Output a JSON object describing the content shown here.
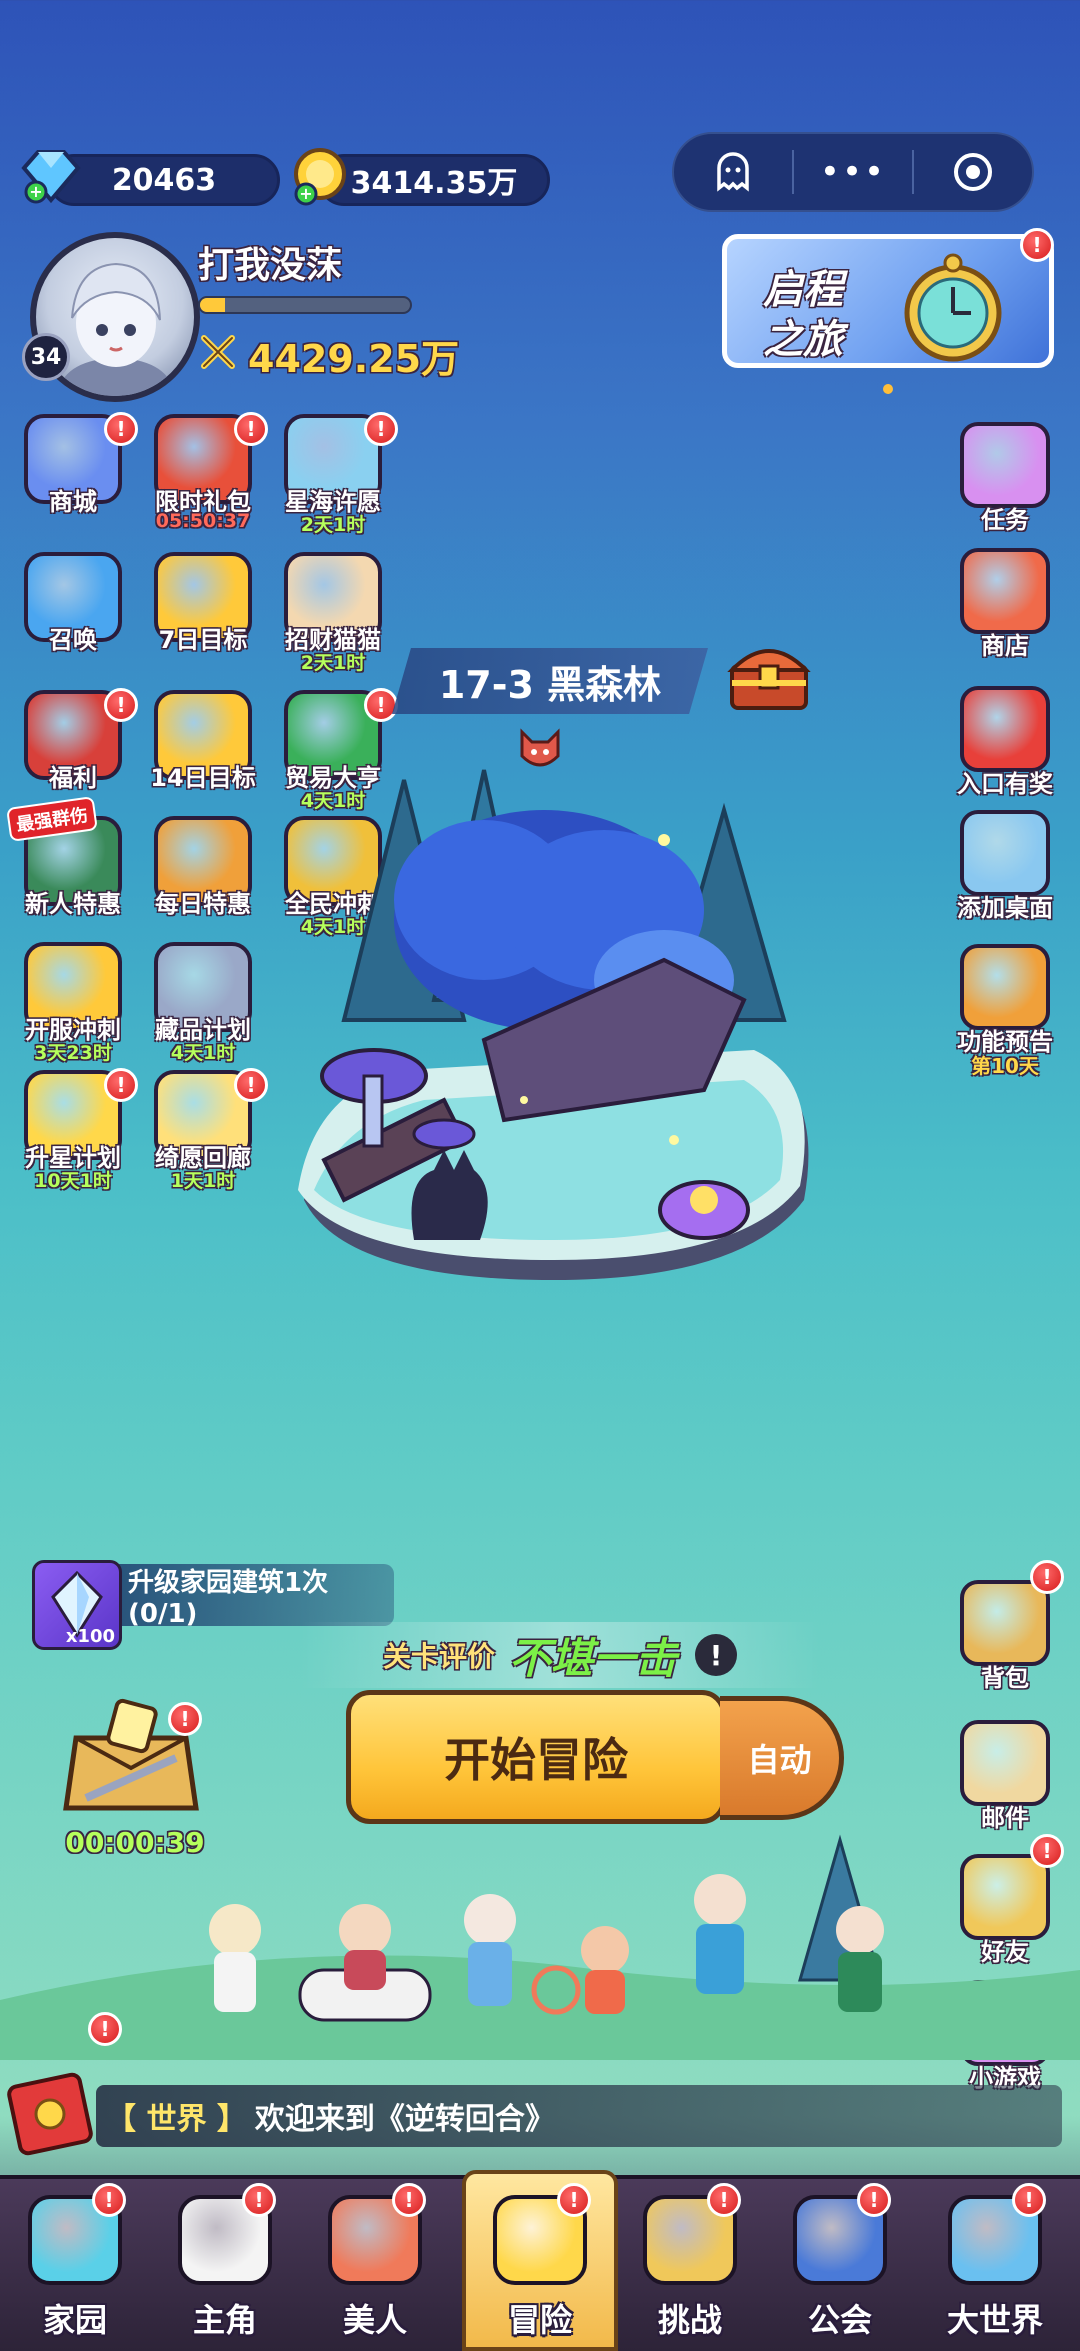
{
  "resources": {
    "diamond": "20463",
    "gold": "3414.35万"
  },
  "capsule": {
    "ghost": "👻",
    "more": "•••",
    "close": "◉"
  },
  "player": {
    "name": "打我没莯",
    "level": "34",
    "power": "4429.25万",
    "exp_fraction": 0.12
  },
  "journey_banner": {
    "line1": "启程",
    "line2": "之旅"
  },
  "left_menu": [
    {
      "label": "商城",
      "sub": ""
    },
    {
      "label": "限时礼包",
      "sub": "05:50:37"
    },
    {
      "label": "星海许愿",
      "sub": "2天1时"
    },
    {
      "label": "召唤",
      "sub": ""
    },
    {
      "label": "7日目标",
      "sub": ""
    },
    {
      "label": "招财猫猫",
      "sub": "2天1时"
    },
    {
      "label": "福利",
      "sub": ""
    },
    {
      "label": "14日目标",
      "sub": ""
    },
    {
      "label": "贸易大亨",
      "sub": "4天1时"
    },
    {
      "label": "新人特惠",
      "sub": "",
      "tag": "最强群伤"
    },
    {
      "label": "每日特惠",
      "sub": ""
    },
    {
      "label": "全民冲刺",
      "sub": "4天1时"
    },
    {
      "label": "开服冲刺",
      "sub": "3天23时"
    },
    {
      "label": "藏品计划",
      "sub": "4天1时"
    },
    {
      "label": "升星计划",
      "sub": "10天1时"
    },
    {
      "label": "绮愿回廊",
      "sub": "1天1时"
    }
  ],
  "right_menu": [
    {
      "label": "任务",
      "sub": ""
    },
    {
      "label": "商店",
      "sub": ""
    },
    {
      "label": "入口有奖",
      "sub": ""
    },
    {
      "label": "添加桌面",
      "sub": ""
    },
    {
      "label": "功能预告",
      "sub": "第10天"
    },
    {
      "label": "背包",
      "sub": ""
    },
    {
      "label": "邮件",
      "sub": ""
    },
    {
      "label": "好友",
      "sub": ""
    },
    {
      "label": "小游戏",
      "sub": ""
    }
  ],
  "stage": {
    "title": "17-3 黑森林"
  },
  "task": {
    "text": "升级家园建筑1次(0/1)",
    "reward_count": "x100"
  },
  "rating": {
    "label": "关卡评价",
    "grade": "不堪一击",
    "info": "!"
  },
  "adventure": {
    "start": "开始冒险",
    "auto": "自动",
    "chest_timer": "00:00:39"
  },
  "chat": {
    "channel": "【 世界 】",
    "message": "欢迎来到《逆转回合》"
  },
  "bottom_nav": [
    {
      "label": "家园"
    },
    {
      "label": "主角"
    },
    {
      "label": "美人"
    },
    {
      "label": "冒险"
    },
    {
      "label": "挑战"
    },
    {
      "label": "公会"
    },
    {
      "label": "大世界"
    }
  ],
  "colors": {
    "accent_gold": "#ffd84a",
    "timer_green": "#b6ff5c",
    "badge_red": "#e0242a",
    "grade_green": "#7cf047"
  }
}
